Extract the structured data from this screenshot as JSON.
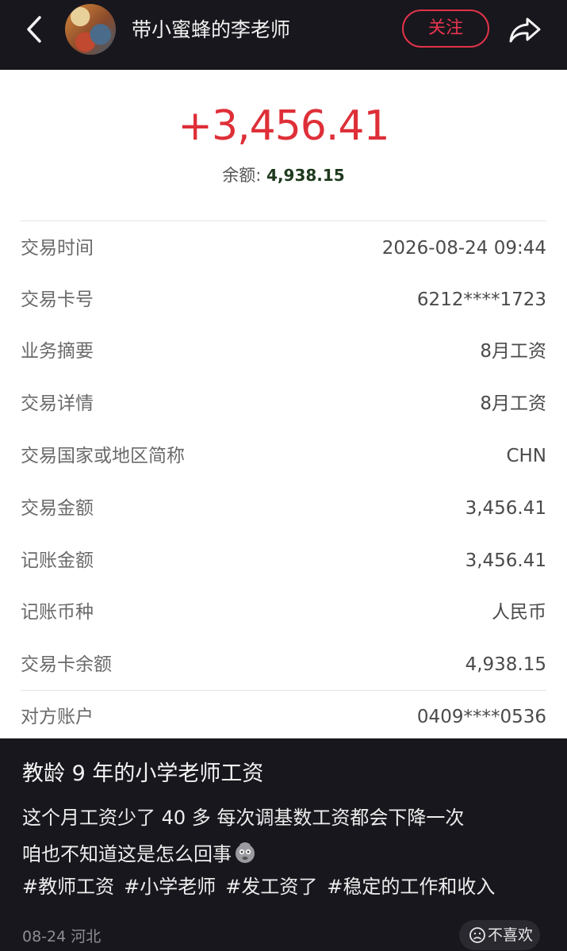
{
  "header": {
    "back_icon": "chevron-left-icon",
    "username": "带小蜜蜂的李老师",
    "follow_label": "关注",
    "share_icon": "share-arrow-icon"
  },
  "transaction": {
    "amount": "+3,456.41",
    "amount_color": "#de2f38",
    "balance_label": "余额:",
    "balance_value": "4,938.15",
    "rows": [
      {
        "label": "交易时间",
        "value": "2026-08-24 09:44"
      },
      {
        "label": "交易卡号",
        "value": "6212****1723"
      },
      {
        "label": "业务摘要",
        "value": "8月工资"
      },
      {
        "label": "交易详情",
        "value": "8月工资"
      },
      {
        "label": "交易国家或地区简称",
        "value": "CHN"
      },
      {
        "label": "交易金额",
        "value": "3,456.41"
      },
      {
        "label": "记账金额",
        "value": "3,456.41"
      },
      {
        "label": "记账币种",
        "value": "人民币"
      },
      {
        "label": "交易卡余额",
        "value": "4,938.15"
      },
      {
        "label": "对方账户",
        "value": "0409****0536"
      }
    ]
  },
  "post": {
    "title": "教龄 9 年的小学老师工资",
    "line1": "这个月工资少了 40 多 每次调基数工资都会下降一次",
    "line2": "咱也不知道这是怎么回事",
    "emoji_icon": "speechless-face-icon",
    "tags": [
      "#教师工资",
      "#小学老师",
      "#发工资了",
      "#稳定的工作和收入"
    ],
    "date_location": "08-24 河北",
    "dislike_label": "不喜欢",
    "dislike_icon": "sad-face-icon"
  }
}
